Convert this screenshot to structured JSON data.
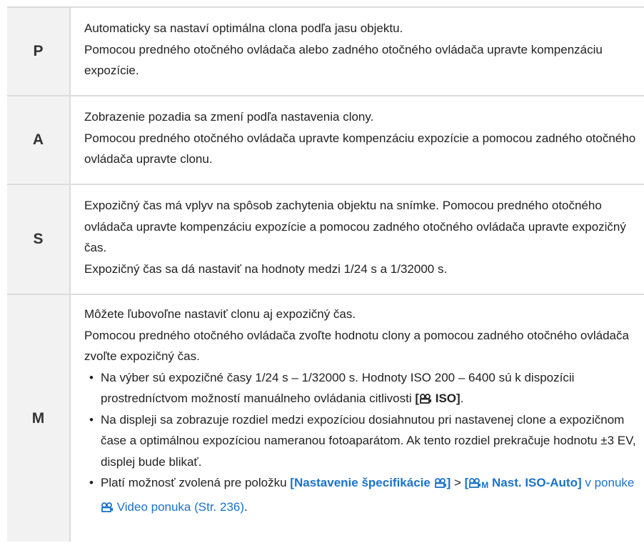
{
  "rows": [
    {
      "mode": "P",
      "lines": [
        "Automaticky sa nastaví optimálna clona podľa jasu objektu.",
        "Pomocou predného otočného ovládača alebo zadného otočného ovládača upravte kompenzáciu expozície."
      ]
    },
    {
      "mode": "A",
      "lines": [
        "Zobrazenie pozadia sa zmení podľa nastavenia clony.",
        "Pomocou predného otočného ovládača upravte kompenzáciu expozície a pomocou zadného otočného ovládača upravte clonu."
      ]
    },
    {
      "mode": "S",
      "lines": [
        "Expozičný čas má vplyv na spôsob zachytenia objektu na snímke. Pomocou predného otočného ovládača upravte kompenzáciu expozície a pomocou zadného otočného ovládača upravte expozičný čas.",
        "Expozičný čas sa dá nastaviť na hodnoty medzi 1/24 s a 1/32000 s."
      ]
    },
    {
      "mode": "M",
      "lines": [
        "Môžete ľubovoľne nastaviť clonu aj expozičný čas.",
        "Pomocou predného otočného ovládača zvoľte hodnotu clony a pomocou zadného otočného ovládača zvoľte expozičný čas."
      ],
      "bullet1_text": "Na výber sú expozičné časy 1/24 s – 1/32000 s. Hodnoty ISO 200 – 6400 sú k dispozícii prostredníctvom možností manuálneho ovládania citlivosti ",
      "bullet1_bold_open": "[",
      "bullet1_bold_iso": " ISO]",
      "bullet1_end": ".",
      "bullet2_text": "Na displeji sa zobrazuje rozdiel medzi expozíciou dosiahnutou pri nastavenej clone a expozičnom čase a optimálnou expozíciou nameranou fotoaparátom. Ak tento rozdiel prekračuje hodnotu ±3 EV, displej bude blikať.",
      "bullet3_pre": "Platí možnosť zvolená pre položku ",
      "bullet3_link1": "[Nastavenie špecifikácie ",
      "bullet3_link1_close": "]",
      "bullet3_sep": " > ",
      "bullet3_link2_open": "[",
      "bullet3_link2_sub": "M",
      "bullet3_link2_rest": " Nast. ISO-Auto]",
      "bullet3_mid": " v ponuke ",
      "bullet3_link3": " Video ponuka (Str. 236)",
      "bullet3_end": "."
    }
  ],
  "colors": {
    "link": "#1a73c9",
    "mode_bg": "#f2f2f2",
    "border": "#dcdcdc"
  },
  "icons": {
    "movie": "movie-camera-icon"
  }
}
